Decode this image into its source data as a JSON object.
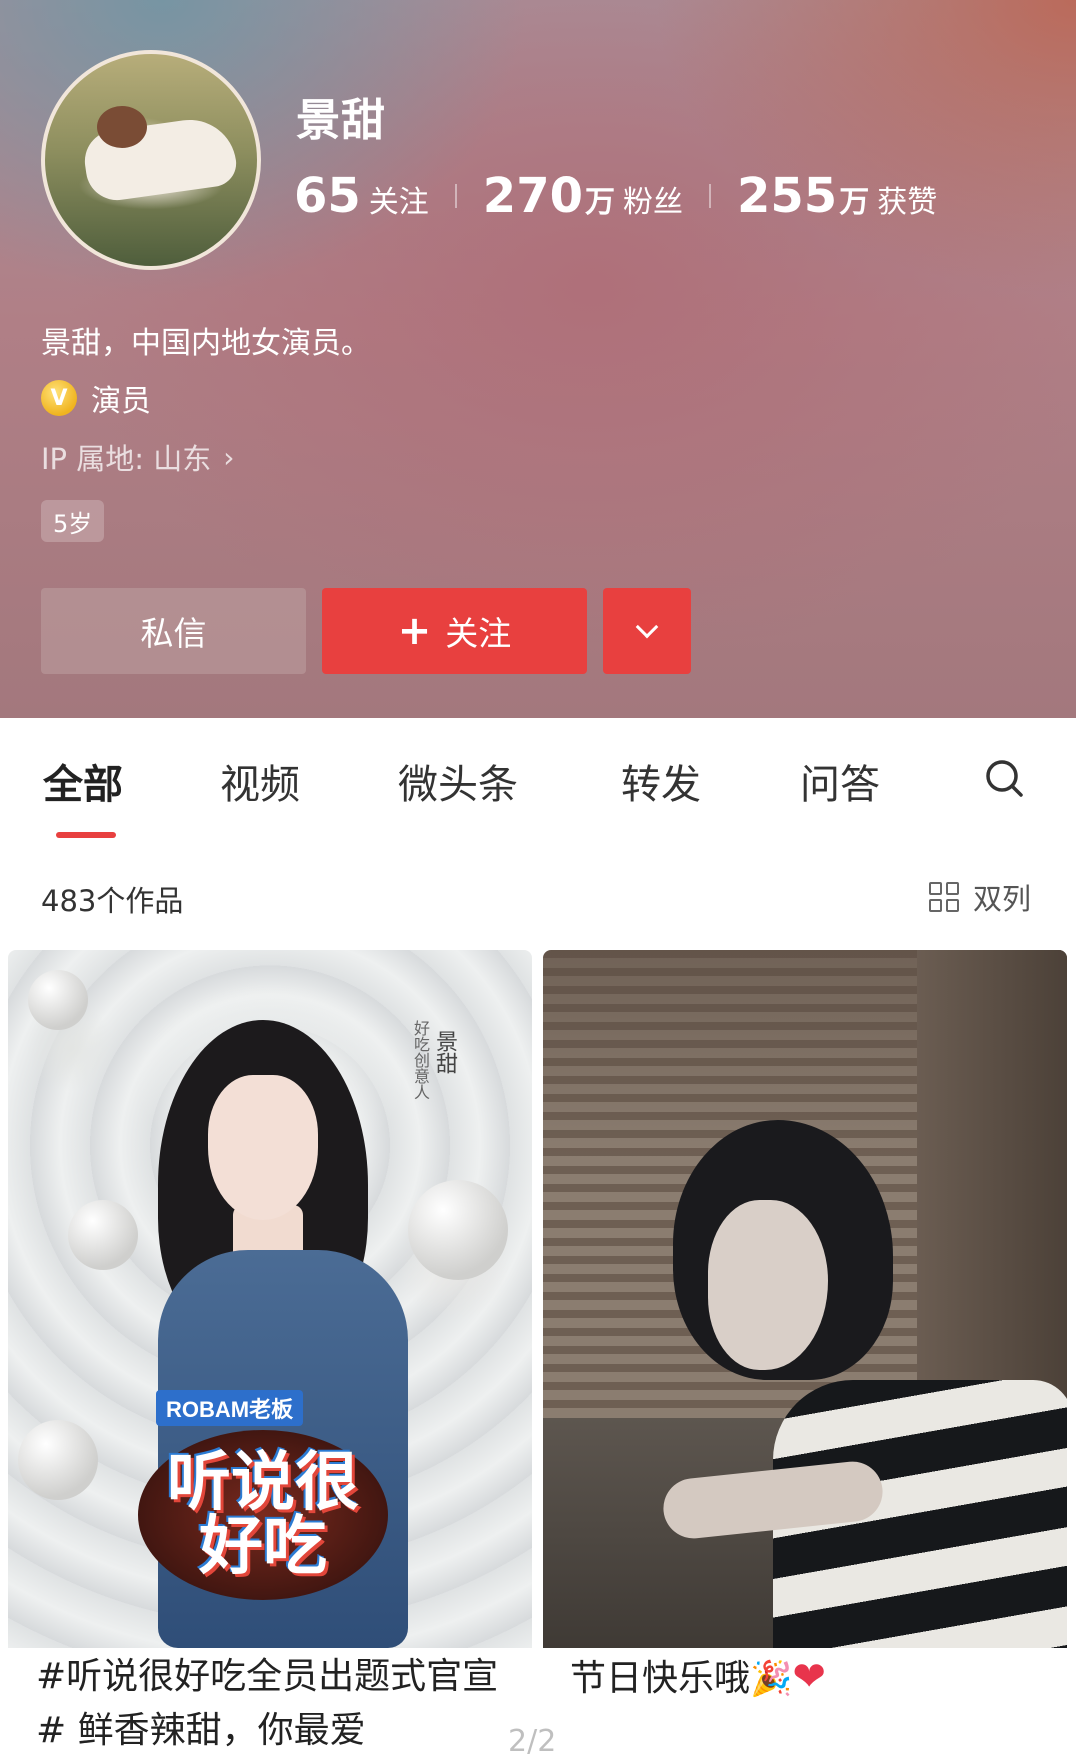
{
  "profile": {
    "name": "景甜",
    "stats": [
      {
        "value": "65",
        "unit": "",
        "label": "关注"
      },
      {
        "value": "270",
        "unit": "万",
        "label": "粉丝"
      },
      {
        "value": "255",
        "unit": "万",
        "label": "获赞"
      }
    ],
    "bio": "景甜，中国内地女演员。",
    "verify_icon": "V",
    "verify_label": "演员",
    "ip_location": "IP 属地: 山东",
    "age_badge": "5岁",
    "colors": {
      "accent": "#e8403f"
    }
  },
  "actions": {
    "message_label": "私信",
    "follow_plus": "+",
    "follow_label": "关注"
  },
  "tabs": [
    {
      "label": "全部",
      "active": true
    },
    {
      "label": "视频"
    },
    {
      "label": "微头条"
    },
    {
      "label": "转发"
    },
    {
      "label": "问答"
    }
  ],
  "works": {
    "count_label": "483个作品",
    "layout_label": "双列"
  },
  "cards": [
    {
      "caption": "#听说很好吃全员出题式官宣# 鲜香辣甜，你最爱",
      "brand_logo": "ROBAM老板",
      "show_logo": "听说很好吃",
      "vertical_text": "好吃创意人",
      "vertical_name": "景甜"
    },
    {
      "caption": "节日快乐哦",
      "emoji_party": "🎉",
      "emoji_heart": "❤"
    }
  ],
  "pager": "2/2"
}
